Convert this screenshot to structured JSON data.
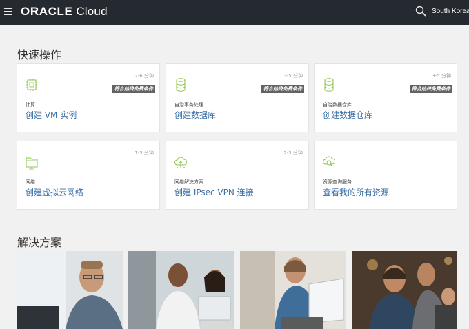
{
  "header": {
    "brand": "ORACLE",
    "product": "Cloud",
    "region": "South Korea Ce"
  },
  "quick_actions": {
    "title": "快速操作",
    "cards": [
      {
        "time": "2-6 分钟",
        "tag": "符合始终免费条件",
        "category": "计算",
        "action": "创建 VM 实例",
        "icon": "chip-icon"
      },
      {
        "time": "3-5 分钟",
        "tag": "符合始终免费条件",
        "category": "自治事务处理",
        "action": "创建数据库",
        "icon": "database-icon"
      },
      {
        "time": "3-5 分钟",
        "tag": "符合始终免费条件",
        "category": "自治数据仓库",
        "action": "创建数据仓库",
        "icon": "database-icon"
      },
      {
        "time": "1-3 分钟",
        "tag": "",
        "category": "网络",
        "action": "创建虚拟云网络",
        "icon": "folder-network-icon"
      },
      {
        "time": "2-3 分钟",
        "tag": "",
        "category": "网络解决方案",
        "action": "创建 IPsec VPN 连接",
        "icon": "cloud-upload-icon"
      },
      {
        "time": "",
        "tag": "",
        "category": "资源查询服务",
        "action": "查看我的所有资源",
        "icon": "cloud-search-icon"
      }
    ]
  },
  "solutions": {
    "title": "解决方案"
  },
  "colors": {
    "topbar": "#252a31",
    "accent": "#3a6ea5",
    "icon_green": "#8bc34a",
    "tag_bg": "#636363"
  }
}
